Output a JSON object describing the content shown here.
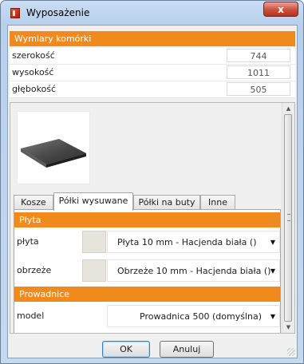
{
  "window": {
    "title": "Wyposażenie",
    "close_label": "x"
  },
  "dimensions": {
    "header": "Wymiary komórki",
    "rows": [
      {
        "label": "szerokość",
        "value": "744"
      },
      {
        "label": "wysokość",
        "value": "1011"
      },
      {
        "label": "głębokość",
        "value": "505"
      }
    ]
  },
  "preview": {
    "icon": "shelf-board-icon"
  },
  "tabs": [
    {
      "label": "Kosze",
      "active": false
    },
    {
      "label": "Półki wysuwane",
      "active": true
    },
    {
      "label": "Półki na buty",
      "active": false
    },
    {
      "label": "Inne",
      "active": false
    }
  ],
  "plate_section": {
    "header": "Płyta",
    "rows": [
      {
        "label": "płyta",
        "value": "Płyta 10 mm - Hacjenda biała ()",
        "swatch_color": "#e6e4dc"
      },
      {
        "label": "obrzeże",
        "value": "Obrzeże 10 mm - Hacjenda biała ()",
        "swatch_color": "#e6e4dc"
      }
    ]
  },
  "guides_section": {
    "header": "Prowadnice",
    "rows": [
      {
        "label": "model",
        "value": "Prowadnica 500 (domyślna)"
      }
    ]
  },
  "buttons": {
    "ok": "OK",
    "cancel": "Anuluj"
  },
  "colors": {
    "accent": "#f08a1c",
    "close_button": "#c9503d"
  }
}
